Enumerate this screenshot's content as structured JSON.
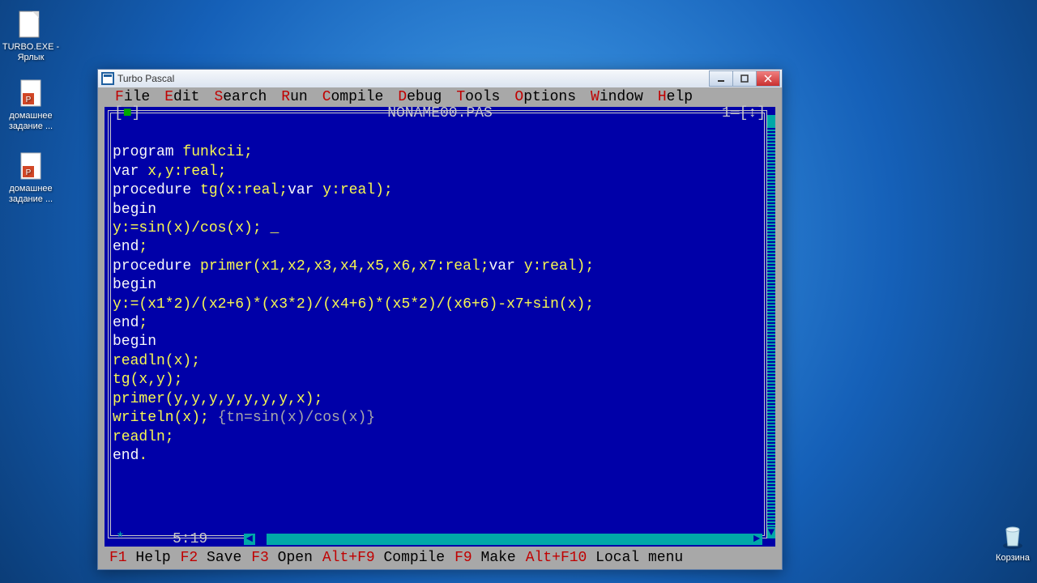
{
  "desktop": {
    "icons": [
      {
        "label": "TURBO.EXE - Ярлык"
      },
      {
        "label": "домашнее задание ..."
      },
      {
        "label": "домашнее задание ..."
      }
    ],
    "recycle": "Корзина"
  },
  "window": {
    "title": "Turbo Pascal",
    "buttons": {
      "min": "minimize",
      "max": "maximize",
      "close": "close"
    }
  },
  "menubar": {
    "items": [
      {
        "hot": "F",
        "rest": "ile"
      },
      {
        "hot": "E",
        "rest": "dit"
      },
      {
        "hot": "S",
        "rest": "earch"
      },
      {
        "hot": "R",
        "rest": "un"
      },
      {
        "hot": "C",
        "rest": "ompile"
      },
      {
        "hot": "D",
        "rest": "ebug"
      },
      {
        "hot": "T",
        "rest": "ools"
      },
      {
        "hot": "O",
        "rest": "ptions"
      },
      {
        "hot": "W",
        "rest": "indow"
      },
      {
        "hot": "H",
        "rest": "elp"
      }
    ]
  },
  "editor": {
    "close_marker_left": "[",
    "close_marker_inner": "■",
    "close_marker_right": "]",
    "filename": "NONAME00.PAS",
    "right_marker": "1═[↕]",
    "cursor_pos": "5:19",
    "hscroll_star": "*",
    "code": {
      "l1a": "program ",
      "l1b": "funkcii;",
      "l2a": "var ",
      "l2b": "x,y:real;",
      "l3a": "procedure ",
      "l3b": "tg(x:real;",
      "l3c": "var ",
      "l3d": "y:real);",
      "l4": "begin",
      "l5a": "y:=sin(x)/cos(x); ",
      "l5cur": "_",
      "l6a": "end",
      "l6b": ";",
      "l7a": "procedure ",
      "l7b": "primer(x1,x2,x3,x4,x5,x6,x7:real;",
      "l7c": "var ",
      "l7d": "y:real);",
      "l8": "begin",
      "l9": "y:=(x1*2)/(x2+6)*(x3*2)/(x4+6)*(x5*2)/(x6+6)-x7+sin(x);",
      "l10a": "end",
      "l10b": ";",
      "l11": "begin",
      "l12": "readln(x);",
      "l13": "tg(x,y);",
      "l14": "primer(y,y,y,y,y,y,y,x);",
      "l15a": "writeln(x); ",
      "l15b": "{tn=sin(x)/cos(x)}",
      "l16": "readln;",
      "l17a": "end",
      "l17b": "."
    }
  },
  "statusbar": {
    "keys": [
      {
        "key": "F1",
        "label": " Help"
      },
      {
        "key": "F2",
        "label": " Save"
      },
      {
        "key": "F3",
        "label": " Open"
      },
      {
        "key": "Alt+F9",
        "label": " Compile"
      },
      {
        "key": "F9",
        "label": " Make"
      },
      {
        "key": "Alt+F10",
        "label": " Local menu"
      }
    ]
  }
}
